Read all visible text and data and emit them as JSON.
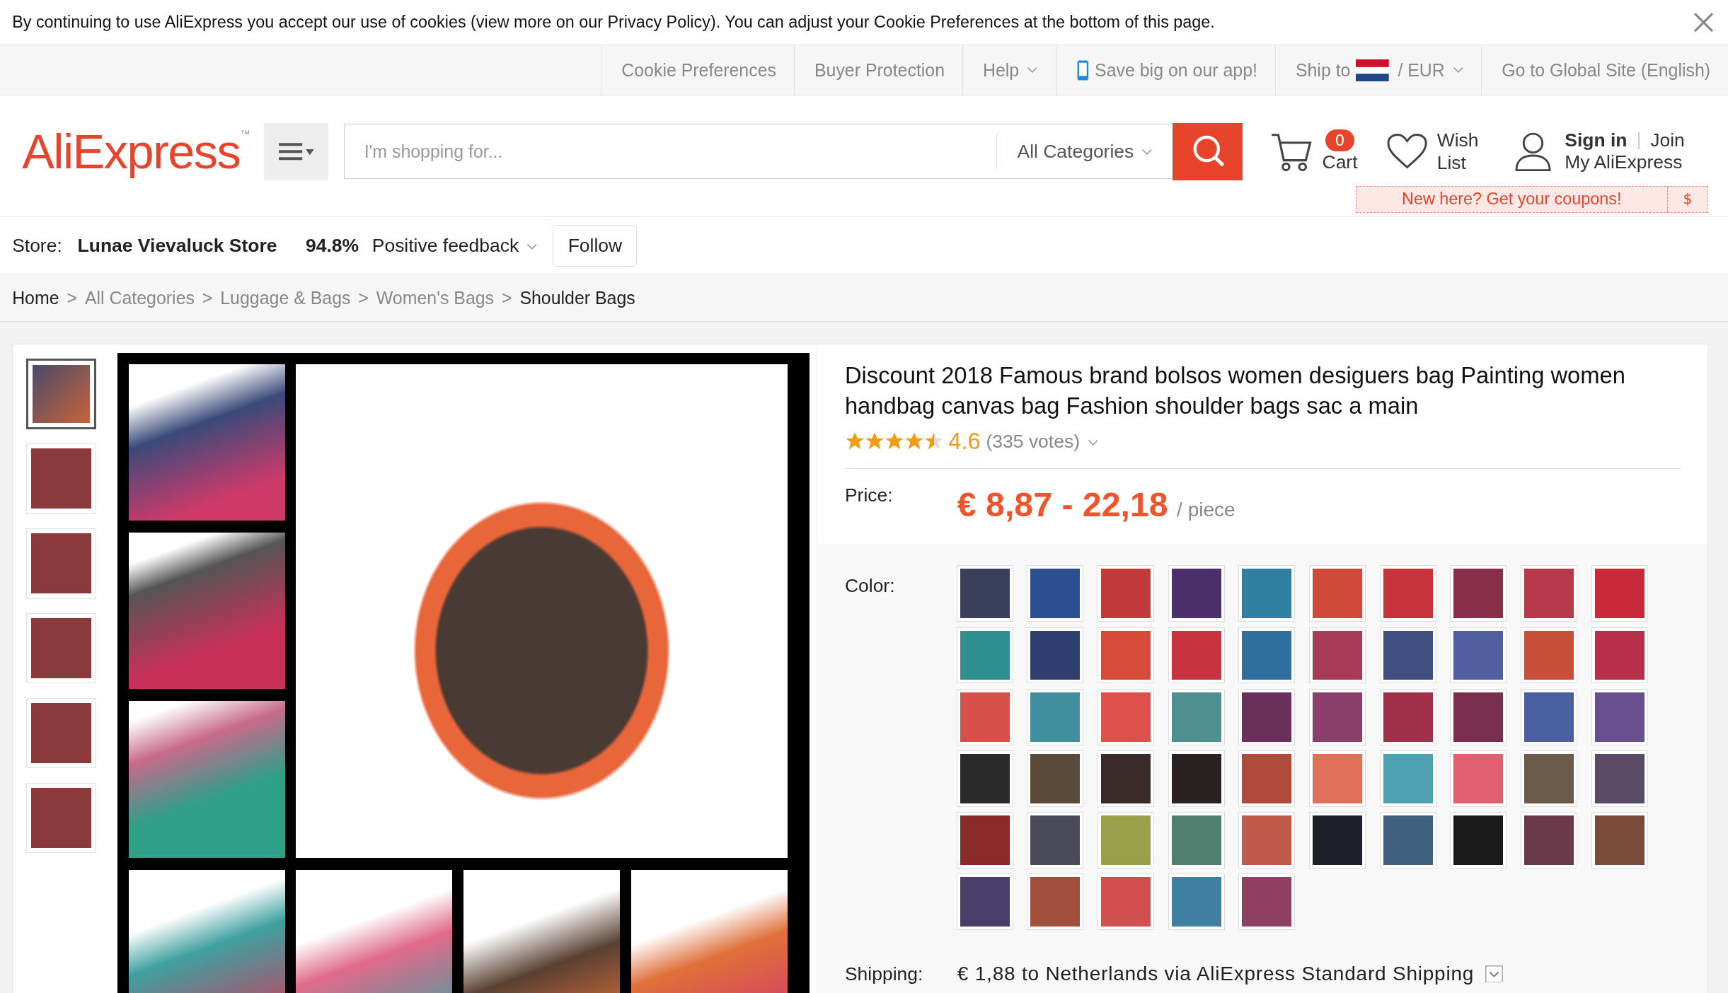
{
  "cookie_bar": {
    "text": "By continuing to use AliExpress you accept our use of cookies (view more on our Privacy Policy). You can adjust your Cookie Preferences at the bottom of this page."
  },
  "top_nav": {
    "links": [
      {
        "label": "Cookie Preferences",
        "kind": "plain"
      },
      {
        "label": "Buyer Protection",
        "kind": "plain"
      },
      {
        "label": "Help",
        "kind": "dropdown"
      },
      {
        "label": "Save big on our app!",
        "kind": "app"
      },
      {
        "label": "Ship to",
        "currency": "/  EUR",
        "kind": "ship"
      },
      {
        "label": "Go to Global Site (English)",
        "kind": "plain"
      }
    ]
  },
  "header": {
    "logo": "AliExpress$^{™}$",
    "search": {
      "placeholder": "I'm shopping for...",
      "category": "All Categories"
    },
    "cart": {
      "count": "0",
      "label": "Cart"
    },
    "wish_list": "Wish List",
    "sign_in": "Sign in",
    "join": "Join",
    "account": "My AliExpress",
    "coupon": "New here? Get your coupons!",
    "coupon_badge": "$"
  },
  "store_bar": {
    "label": "Store:",
    "name": "Lunae Vievaluck Store",
    "score": "94.8%",
    "feedback": "Positive feedback",
    "follow": "Follow"
  },
  "breadcrumbs": [
    {
      "label": "Home"
    },
    {
      "separator": ">",
      "label": "All Categories"
    },
    {
      "separator": ">",
      "label": "Luggage & Bags"
    },
    {
      "separator": ">",
      "label": "Women's Bags"
    },
    {
      "separator": ">",
      "label": "Shoulder Bags"
    }
  ],
  "thumbnails": [
    {
      "selected": true
    },
    {
      "selected": false
    },
    {
      "selected": false
    },
    {
      "selected": false
    },
    {
      "selected": false
    },
    {
      "selected": false
    }
  ],
  "product": {
    "title": "Discount 2018 Famous brand bolsos women desiguers bag Painting women handbag canvas bag Fashion shoulder bags sac a main",
    "rating": {
      "stars": 4.5,
      "score": "4.6",
      "votes": "(335 votes)"
    },
    "price_label": "Price:",
    "price": "€ 8,87 - 22,18",
    "unit": "/ piece",
    "color_label": "Color:",
    "shipping_label": "Shipping:",
    "shipping": "€ 1,88 to Netherlands via AliExpress Standard Shipping"
  },
  "color_options": [
    {
      "color": "#3a3f5c"
    },
    {
      "color": "#2b4f8f"
    },
    {
      "color": "#c23a3a"
    },
    {
      "color": "#4a2f6a"
    },
    {
      "color": "#2f7fa0"
    },
    {
      "color": "#d04a3a"
    },
    {
      "color": "#c8323a"
    },
    {
      "color": "#8a2f4a"
    },
    {
      "color": "#b83a4a"
    },
    {
      "color": "#c82a3a"
    },
    {
      "color": "#2f8f8f"
    },
    {
      "color": "#2f3f6f"
    },
    {
      "color": "#d84a3a"
    },
    {
      "color": "#c8333f"
    },
    {
      "color": "#2f6f9f"
    },
    {
      "color": "#a83a5a"
    },
    {
      "color": "#3f4f7f"
    },
    {
      "color": "#4f5f9f"
    },
    {
      "color": "#c8503a"
    },
    {
      "color": "#b82f4a"
    },
    {
      "color": "#d8504a"
    },
    {
      "color": "#3f8f9f"
    },
    {
      "color": "#e0504a"
    },
    {
      "color": "#4f8f8f"
    },
    {
      "color": "#6a2f5a"
    },
    {
      "color": "#8a3f6a"
    },
    {
      "color": "#a0304a"
    },
    {
      "color": "#7a2f4f"
    },
    {
      "color": "#4a5f9f"
    },
    {
      "color": "#6a4f8f"
    },
    {
      "color": "#2a2a2a"
    },
    {
      "color": "#5a4a3a"
    },
    {
      "color": "#3a2a2a"
    },
    {
      "color": "#2a2222"
    },
    {
      "color": "#b04a3a"
    },
    {
      "color": "#e0705a"
    },
    {
      "color": "#4fa0b0"
    },
    {
      "color": "#e06070"
    },
    {
      "color": "#6a5a4a"
    },
    {
      "color": "#5a4a6a"
    },
    {
      "color": "#8a2a2a"
    },
    {
      "color": "#4a4a5a"
    },
    {
      "color": "#9aa04a"
    },
    {
      "color": "#4f7f6f"
    },
    {
      "color": "#c05a4a"
    },
    {
      "color": "#1f1f2a"
    },
    {
      "color": "#3f5f7f"
    },
    {
      "color": "#1a1a1a"
    },
    {
      "color": "#6a3a4a"
    },
    {
      "color": "#7a4a3a"
    },
    {
      "color": "#4a3f6a"
    },
    {
      "color": "#a0503a"
    },
    {
      "color": "#d0504f"
    },
    {
      "color": "#3f7f9f"
    },
    {
      "color": "#8f3f5f"
    }
  ]
}
